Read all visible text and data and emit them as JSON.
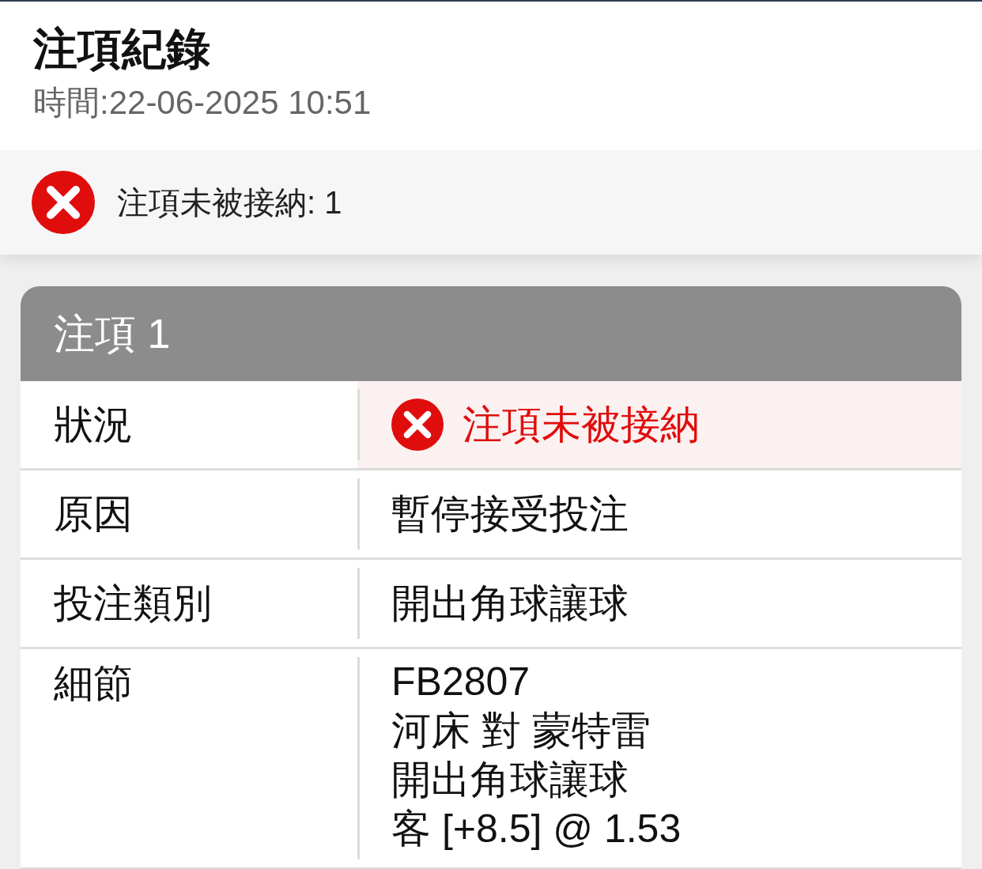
{
  "header": {
    "title": "注項紀錄",
    "time": "時間:22-06-2025 10:51"
  },
  "summary": {
    "accepted": false,
    "text": "注項未被接納: 1"
  },
  "bets": [
    {
      "title": "注項 1",
      "rows": [
        {
          "label": "狀況",
          "kind": "status",
          "accepted": false,
          "value": "注項未被接納"
        },
        {
          "label": "原因",
          "kind": "text",
          "value": "暫停接受投注"
        },
        {
          "label": "投注類別",
          "kind": "text",
          "value": "開出角球讓球"
        },
        {
          "label": "細節",
          "kind": "lines",
          "lines": [
            "FB2807",
            "河床 對 蒙特雷",
            "開出角球讓球",
            "客 [+8.5] @ 1.53"
          ]
        }
      ]
    }
  ]
}
